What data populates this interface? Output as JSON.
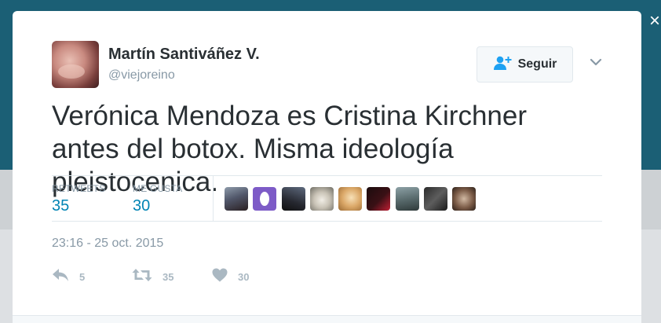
{
  "page": {
    "close_label": "×"
  },
  "tweet": {
    "author_name": "Martín Santiváñez V.",
    "author_handle": "@viejoreino",
    "follow_label": "Seguir",
    "text": "Verónica Mendoza es Cristina Kirchner antes del botox. Misma ideología pleistocenica.",
    "stats": {
      "retweets_label": "RETWEETS",
      "retweets_value": "35",
      "likes_label": "ME GUSTA",
      "likes_value": "30"
    },
    "liker_avatar_count": 9,
    "timestamp": "23:16 - 25 oct. 2015",
    "actions": {
      "reply_count": "5",
      "retweet_count": "35",
      "like_count": "30"
    }
  },
  "icons": {
    "follow": "add-user-icon",
    "menu": "chevron-down-icon",
    "reply": "reply-icon",
    "retweet": "retweet-icon",
    "like": "heart-icon",
    "close": "close-icon"
  },
  "colors": {
    "header_background": "#1b5f75",
    "link_blue": "#0084b4",
    "follow_icon_blue": "#1da1f2",
    "text_primary": "#292f33",
    "text_secondary": "#8899a6",
    "action_grey": "#aab8c2"
  }
}
